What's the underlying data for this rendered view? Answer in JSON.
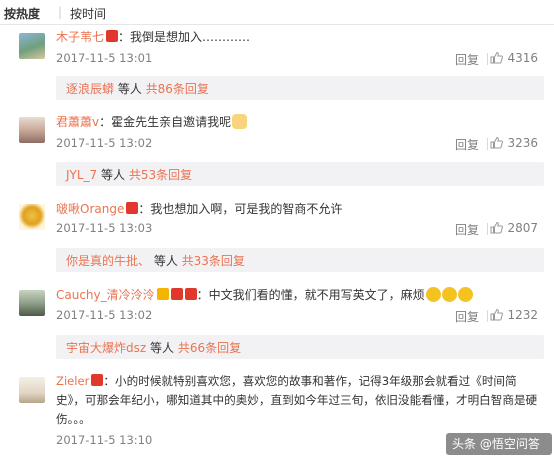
{
  "tabs": {
    "hot": "按热度",
    "separator": "|",
    "time": "按时间"
  },
  "labels": {
    "reply": "回复"
  },
  "comments": [
    {
      "user": "木子苇七",
      "text": "我倒是想加入…………",
      "time": "2017-11-5 13:01",
      "likes": "4316",
      "sub_user": "逐浪辰蟒",
      "sub_mid": " 等人 ",
      "sub_count": "共86条回复"
    },
    {
      "user": "君蕭蕭v",
      "text": "霍金先生亲自邀请我呢",
      "time": "2017-11-5 13:02",
      "likes": "3236",
      "sub_user": "JYL_7",
      "sub_mid": " 等人 ",
      "sub_count": "共53条回复"
    },
    {
      "user": "啵啾Orange",
      "text": "我也想加入啊，可是我的智商不允许",
      "time": "2017-11-5 13:03",
      "likes": "2807",
      "sub_user": "你是真的牛批、",
      "sub_mid": " 等人 ",
      "sub_count": "共33条回复"
    },
    {
      "user": "Cauchy_清冷泠泠",
      "text": "中文我们看的懂，就不用写英文了，麻烦",
      "time": "2017-11-5 13:02",
      "likes": "1232",
      "sub_user": "宇宙大爆炸dsz",
      "sub_mid": " 等人 ",
      "sub_count": "共66条回复"
    },
    {
      "user": "Zieler",
      "text_line1": "小的时候就特别喜欢您，喜欢您的故事和著作，记得3年级那会就看过《时间简",
      "text_line2": "史》，可那会年纪小，哪知道其中的奥妙，直到如今年过三旬，依旧没能看懂，才明白智商是硬",
      "text_line3": "伤。。。",
      "time": "2017-11-5 13:10"
    }
  ],
  "watermark": "头条 @悟空问答"
}
